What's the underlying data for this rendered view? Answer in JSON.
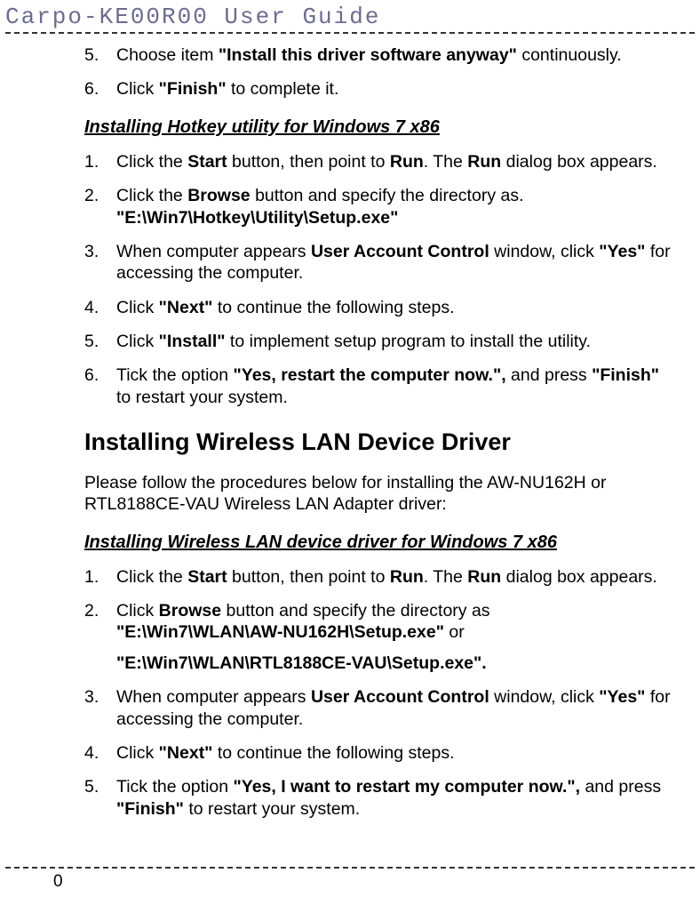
{
  "header": {
    "title": "Carpo-KE00R00 User Guide"
  },
  "topList": {
    "item5_num": "5.",
    "item5_pre": "Choose item ",
    "item5_bold": "\"Install this driver software anyway\"",
    "item5_post": " continuously.",
    "item6_num": "6.",
    "item6_pre": "Click ",
    "item6_bold": "\"Finish\"",
    "item6_post": " to complete it."
  },
  "hotkey": {
    "heading": "Installing Hotkey utility for Windows 7 x86",
    "s1_num": "1.",
    "s1_a": "Click the ",
    "s1_b": "Start",
    "s1_c": " button, then point to ",
    "s1_d": "Run",
    "s1_e": ". The ",
    "s1_f": "Run",
    "s1_g": " dialog box appears.",
    "s2_num": "2.",
    "s2_a": "Click the ",
    "s2_b": "Browse",
    "s2_c": " button and specify the directory as.",
    "s2_path": "\"E:\\Win7\\Hotkey\\Utility\\Setup.exe\"",
    "s3_num": "3.",
    "s3_a": "When computer appears ",
    "s3_b": "User Account Control",
    "s3_c": " window, click ",
    "s3_d": "\"Yes\"",
    "s3_e": " for accessing the computer.",
    "s4_num": "4.",
    "s4_a": "Click ",
    "s4_b": "\"Next\"",
    "s4_c": " to continue the following steps.",
    "s5_num": "5.",
    "s5_a": "Click ",
    "s5_b": "\"Install\"",
    "s5_c": " to implement setup program to install the utility.",
    "s6_num": "6.",
    "s6_a": "Tick the option ",
    "s6_b": "\"Yes, restart the computer now.\",",
    "s6_c": " and press ",
    "s6_d": "\"Finish\"",
    "s6_e": " to restart your system."
  },
  "wlan": {
    "heading": "Installing Wireless LAN Device Driver",
    "intro": "Please follow the procedures below for installing the AW-NU162H or RTL8188CE-VAU Wireless LAN Adapter driver:",
    "subheading": "Installing Wireless LAN device driver for Windows 7 x86",
    "s1_num": "1.",
    "s1_a": "Click the ",
    "s1_b": "Start",
    "s1_c": " button, then point to ",
    "s1_d": "Run",
    "s1_e": ". The ",
    "s1_f": "Run",
    "s1_g": " dialog box appears.",
    "s2_num": "2.",
    "s2_a": "Click ",
    "s2_b": "Browse",
    "s2_c": " button and specify the directory as",
    "s2_path1": "\"E:\\Win7\\WLAN\\AW-NU162H\\Setup.exe\"",
    "s2_or": " or",
    "s2_path2": "\"E:\\Win7\\WLAN\\RTL8188CE-VAU\\Setup.exe\".",
    "s3_num": "3.",
    "s3_a": "When computer appears ",
    "s3_b": "User Account Control",
    "s3_c": " window, click ",
    "s3_d": "\"Yes\"",
    "s3_e": " for accessing the computer.",
    "s4_num": "4.",
    "s4_a": "Click ",
    "s4_b": "\"Next\"",
    "s4_c": " to continue the following steps.",
    "s5_num": "5.",
    "s5_a": "Tick the option ",
    "s5_b": "\"Yes, I want to restart my computer now.\",",
    "s5_c": " and press ",
    "s5_d": "\"Finish\"",
    "s5_e": " to restart your system."
  },
  "footer": {
    "pageNum": "0"
  }
}
